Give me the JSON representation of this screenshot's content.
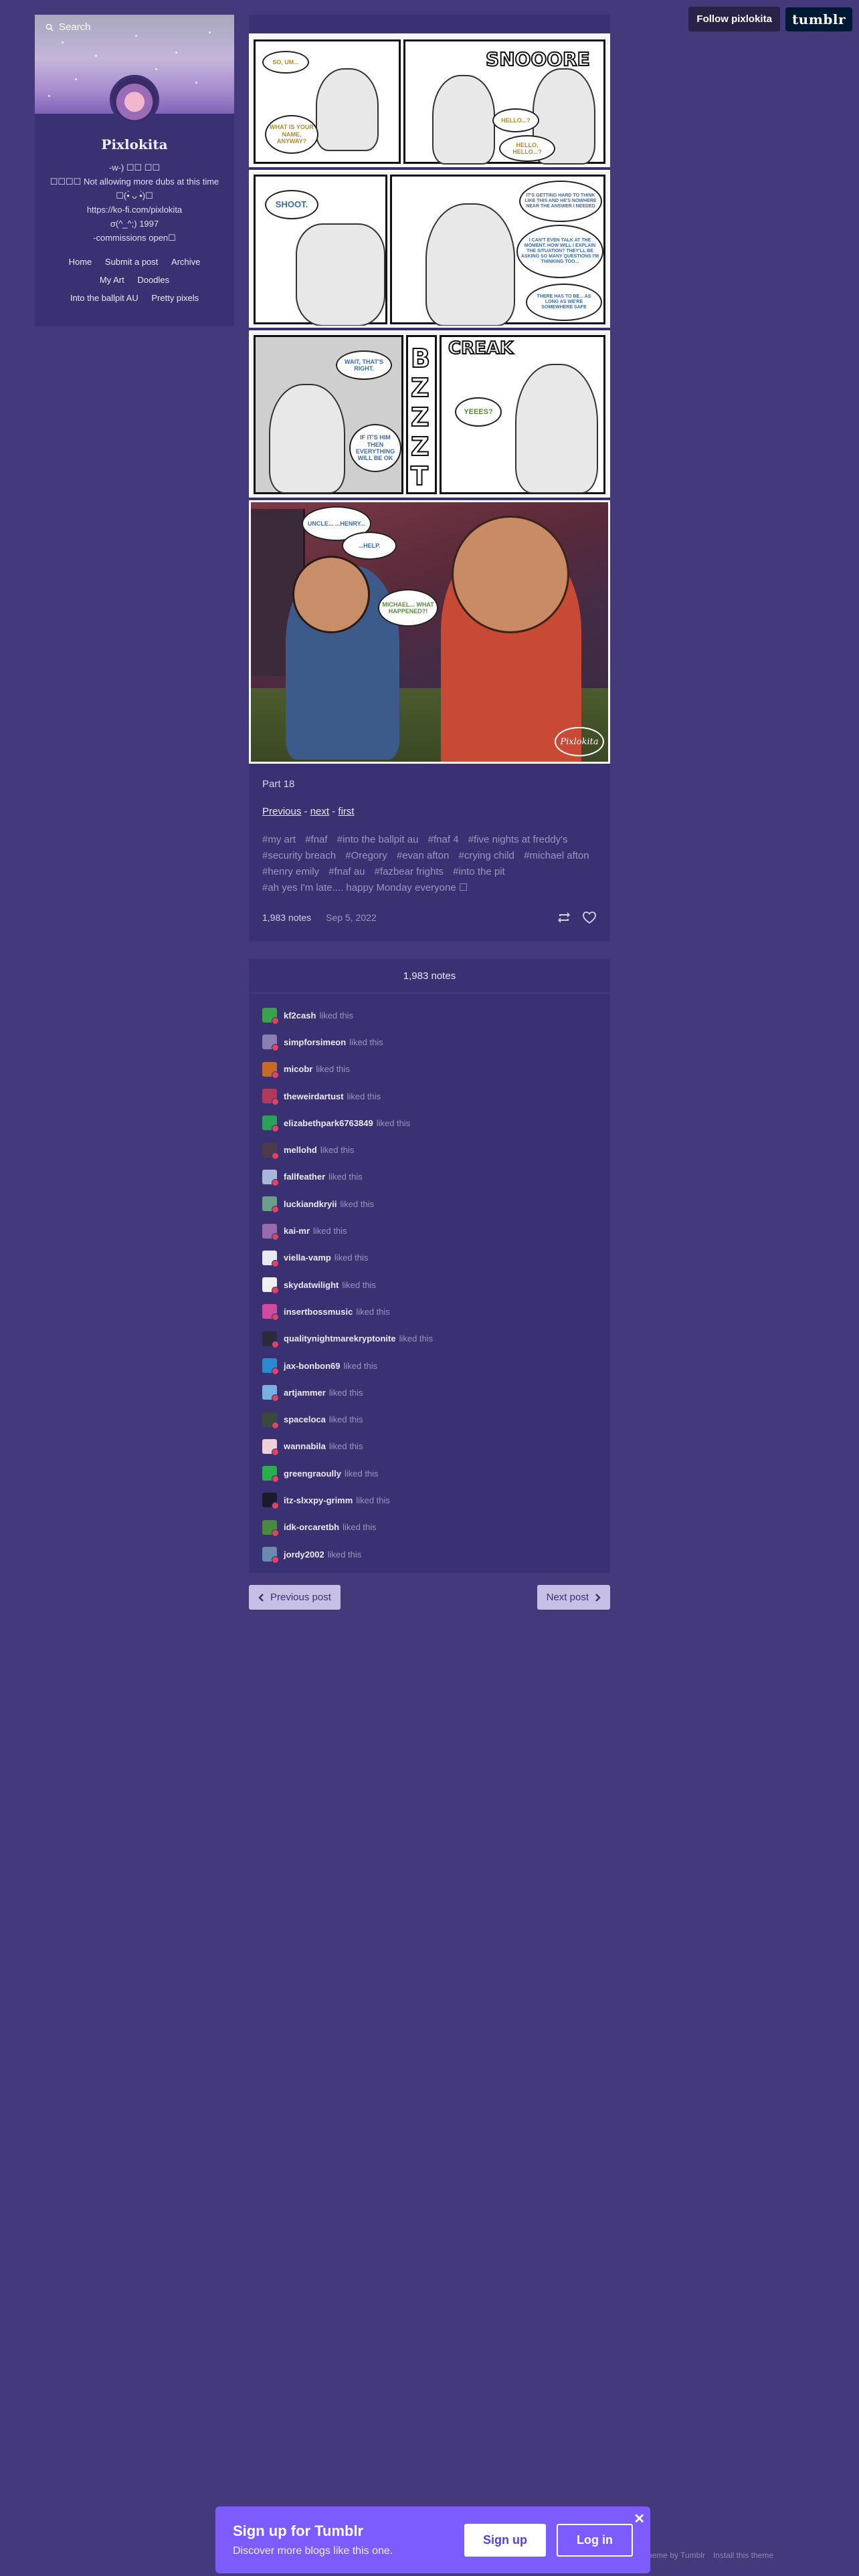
{
  "topbar": {
    "follow_label": "Follow pixlokita",
    "logo_text": "tumblr"
  },
  "sidebar": {
    "search_placeholder": "Search",
    "blog_name": "Pixlokita",
    "description": [
      "-w-) ☐☐ ☐☐",
      "☐☐☐☐ Not allowing more dubs at this time",
      "☐(•̀ ᴗ •̀)☐",
      "https://ko-fi.com/pixlokita",
      "σ(^_^;) 1997",
      "-commissions open☐"
    ],
    "nav_rows": [
      [
        "Home",
        "Submit a post",
        "Archive"
      ],
      [
        "My Art",
        "Doodles"
      ],
      [
        "Into the ballpit AU",
        "Pretty pixels"
      ]
    ]
  },
  "comic": {
    "panel1": {
      "b1": "SO, UM...",
      "b2": "WHAT IS YOUR NAME, ANYWAY?",
      "sfx": "SNOOORE",
      "b3": "HELLO...?",
      "b4": "HELLO, HELLO...?"
    },
    "panel2": {
      "b1": "SHOOT.",
      "b2": "IT'S GETTING HARD TO THINK LIKE THIS AND HE'S NOWHERE NEAR THE ANSWER I NEEDED",
      "b3": "I CAN'T EVEN TALK AT THE MOMENT. HOW WILL I EXPLAIN THE SITUATION? THEY'LL BE ASKING SO MANY QUESTIONS I'M THINKING TOO...",
      "b4": "THERE HAS TO BE... AS LONG AS WE'RE SOMEWHERE SAFE"
    },
    "panel3": {
      "b1": "WAIT, THAT'S RIGHT.",
      "b2": "IF IT'S HIM THEN EVERYTHING WILL BE OK",
      "sfx1": "BZZZT",
      "sfx2": "CREAK",
      "b3": "YEEES?"
    },
    "panel4": {
      "b1": "UNCLE... ...HENRY...",
      "b2": "...HELP.",
      "b3": "MICHAEL... WHAT HAPPENED?!",
      "signature": "Pixlokita"
    }
  },
  "post": {
    "caption": "Part 18",
    "nav": {
      "previous": "Previous",
      "sep1": " - ",
      "next": "next",
      "sep2": " - ",
      "first": "first"
    },
    "tags": [
      "#my art",
      "#fnaf",
      "#into the ballpit au",
      "#fnaf 4",
      "#five nights at freddy's",
      "#security breach",
      "#Oregory",
      "#evan afton",
      "#crying child",
      "#michael afton",
      "#henry emily",
      "#fnaf au",
      "#fazbear frights",
      "#into the pit",
      "#ah yes I'm late.... happy Monday everyone ☐"
    ],
    "notes_count": "1,983 notes",
    "date": "Sep 5, 2022"
  },
  "notes": {
    "header": "1,983 notes",
    "items": [
      {
        "user": "kf2cash",
        "action": "liked this",
        "color": "#3aa34a"
      },
      {
        "user": "simpforsimeon",
        "action": "liked this",
        "color": "#8a7fb0"
      },
      {
        "user": "micobr",
        "action": "liked this",
        "color": "#c66a2a"
      },
      {
        "user": "theweirdartust",
        "action": "liked this",
        "color": "#b03a5a"
      },
      {
        "user": "elizabethpark6763849",
        "action": "liked this",
        "color": "#2aa05a"
      },
      {
        "user": "mellohd",
        "action": "liked this",
        "color": "#4a3a4a"
      },
      {
        "user": "fallfeather",
        "action": "liked this",
        "color": "#a8b6d8"
      },
      {
        "user": "luckiandkryii",
        "action": "liked this",
        "color": "#6aa08a"
      },
      {
        "user": "kai-mr",
        "action": "liked this",
        "color": "#9a6ab0"
      },
      {
        "user": "viella-vamp",
        "action": "liked this",
        "color": "#e8e8f0"
      },
      {
        "user": "skydatwilight",
        "action": "liked this",
        "color": "#f0f0f0"
      },
      {
        "user": "insertbossmusic",
        "action": "liked this",
        "color": "#d04aa0"
      },
      {
        "user": "qualitynightmarekryptonite",
        "action": "liked this",
        "color": "#2a2a3a"
      },
      {
        "user": "jax-bonbon69",
        "action": "liked this",
        "color": "#2a8ad0"
      },
      {
        "user": "artjammer",
        "action": "liked this",
        "color": "#7ab0e0"
      },
      {
        "user": "spaceloca",
        "action": "liked this",
        "color": "#3a4a3a"
      },
      {
        "user": "wannabila",
        "action": "liked this",
        "color": "#f0d0d8"
      },
      {
        "user": "greengraoully",
        "action": "liked this",
        "color": "#2ab04a"
      },
      {
        "user": "itz-slxxpy-grimm",
        "action": "liked this",
        "color": "#1a1a2a"
      },
      {
        "user": "idk-orcaretbh",
        "action": "liked this",
        "color": "#4a8a3a"
      },
      {
        "user": "jordy2002",
        "action": "liked this",
        "color": "#6a8ab0"
      }
    ]
  },
  "pager": {
    "previous": "Previous post",
    "next": "Next post"
  },
  "footer": {
    "theme_by": "Theme by Tumblr",
    "install": "Install this theme"
  },
  "signup": {
    "title": "Sign up for Tumblr",
    "subtitle": "Discover more blogs like this one.",
    "signup_label": "Sign up",
    "login_label": "Log in",
    "close_glyph": "✕"
  },
  "colors": {
    "page_bg": "#443a7b",
    "panel_bg": "#3a3172",
    "accent": "#7c5cff",
    "tag": "#9d94c3"
  }
}
